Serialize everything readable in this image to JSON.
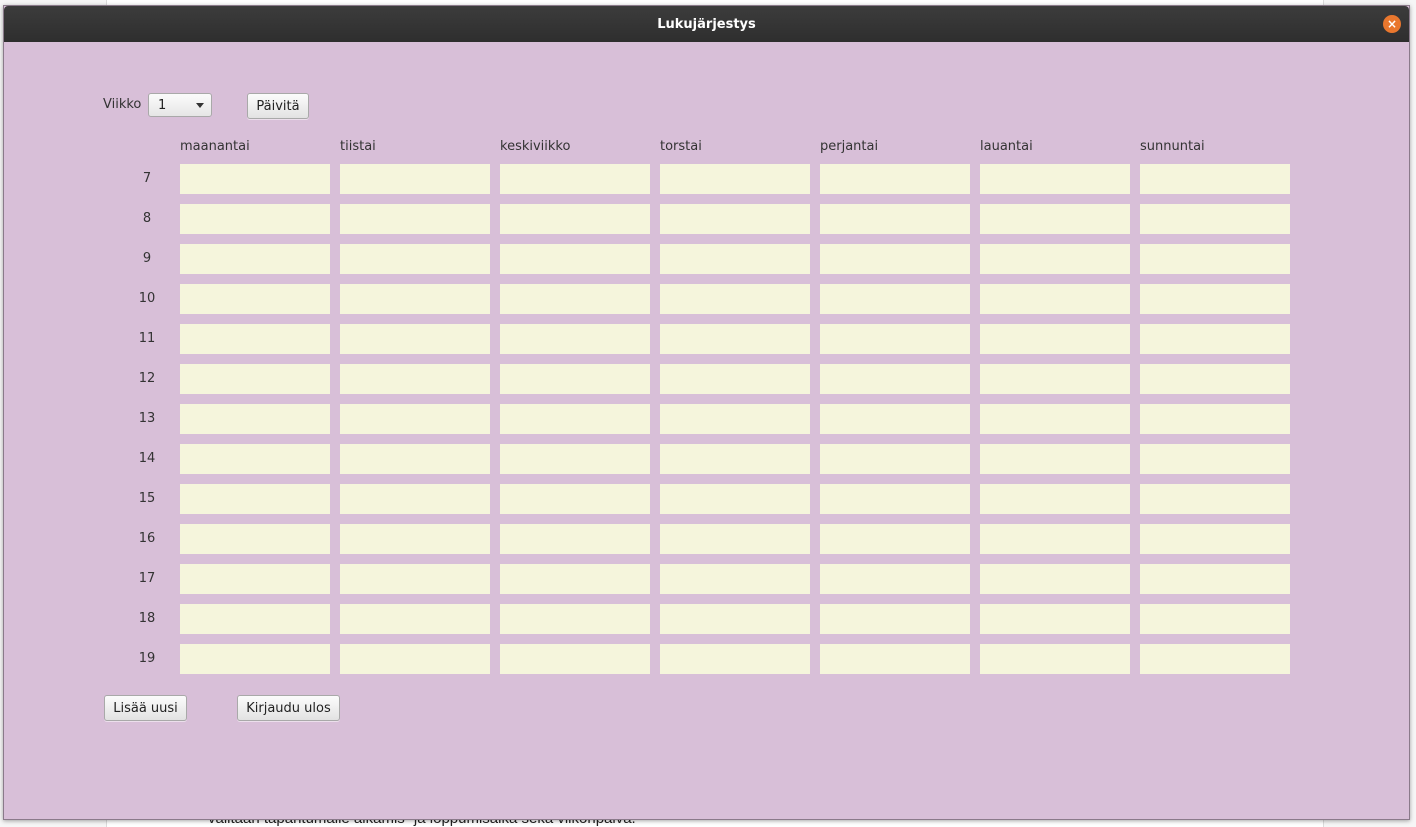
{
  "window": {
    "title": "Lukujärjestys",
    "close_icon": "close-icon"
  },
  "controls": {
    "week_label": "Viikko",
    "week_value": "1",
    "refresh_label": "Päivitä",
    "add_label": "Lisää uusi",
    "logout_label": "Kirjaudu ulos"
  },
  "days": [
    "maanantai",
    "tiistai",
    "keskiviikko",
    "torstai",
    "perjantai",
    "lauantai",
    "sunnuntai"
  ],
  "hours": [
    "7",
    "8",
    "9",
    "10",
    "11",
    "12",
    "13",
    "14",
    "15",
    "16",
    "17",
    "18",
    "19"
  ],
  "background_text": "valitaan tapahtumalle alkamis- ja loppumisaika sekä viikonpäivä.",
  "colors": {
    "window_bg": "#d8bfd8",
    "cell_bg": "#f5f5dc",
    "titlebar": "#333333",
    "close": "#e9772e"
  }
}
